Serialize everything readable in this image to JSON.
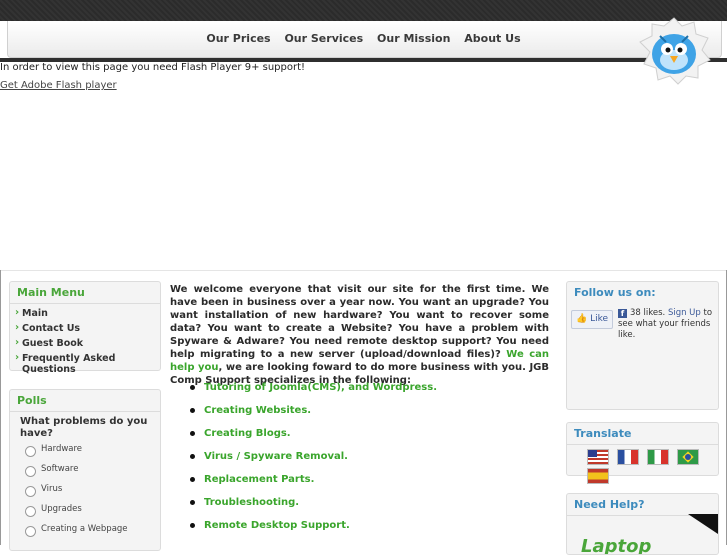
{
  "nav": {
    "items": [
      "Our Prices",
      "Our Services",
      "Our Mission",
      "About Us"
    ]
  },
  "flash": {
    "message": "In order to view this page you need Flash Player 9+ support!",
    "link": "Get Adobe Flash player"
  },
  "main_menu": {
    "title": "Main Menu",
    "items": [
      "Main",
      "Contact Us",
      "Guest Book",
      "Frequently Asked Questions"
    ]
  },
  "polls": {
    "title": "Polls",
    "question": "What problems do you have?",
    "options": [
      "Hardware",
      "Software",
      "Virus",
      "Upgrades",
      "Creating a Webpage"
    ]
  },
  "main": {
    "intro": "We welcome everyone that visit our site for the first time. We have been in business over a year now. You want an upgrade? You want installation of new hardware? You want to recover some data? You want to create a Website? You have a problem with Spyware & Adware? You need remote desktop support? You need help migrating to a new server (upload/download files)?",
    "intro_green": "We can help you",
    "intro_tail": ", we are looking foward to do more business with you. JGB Comp Support specializes in the following:",
    "services": [
      "Tutoring of Joomla(CMS),  and Wordpress.",
      "Creating Websites.",
      "Creating Blogs.",
      "Virus / Spyware Removal.",
      "Replacement Parts.",
      "Troubleshooting.",
      "Remote Desktop Support."
    ]
  },
  "follow": {
    "title": "Follow us on:",
    "like_button": "Like",
    "likes_text": "38 likes.",
    "signup": "Sign Up",
    "tail": "to see what your friends like."
  },
  "translate": {
    "title": "Translate",
    "flags": [
      "us-flag",
      "france-flag",
      "italy-flag",
      "brazil-flag",
      "spain-flag"
    ]
  },
  "help": {
    "title": "Need Help?"
  }
}
